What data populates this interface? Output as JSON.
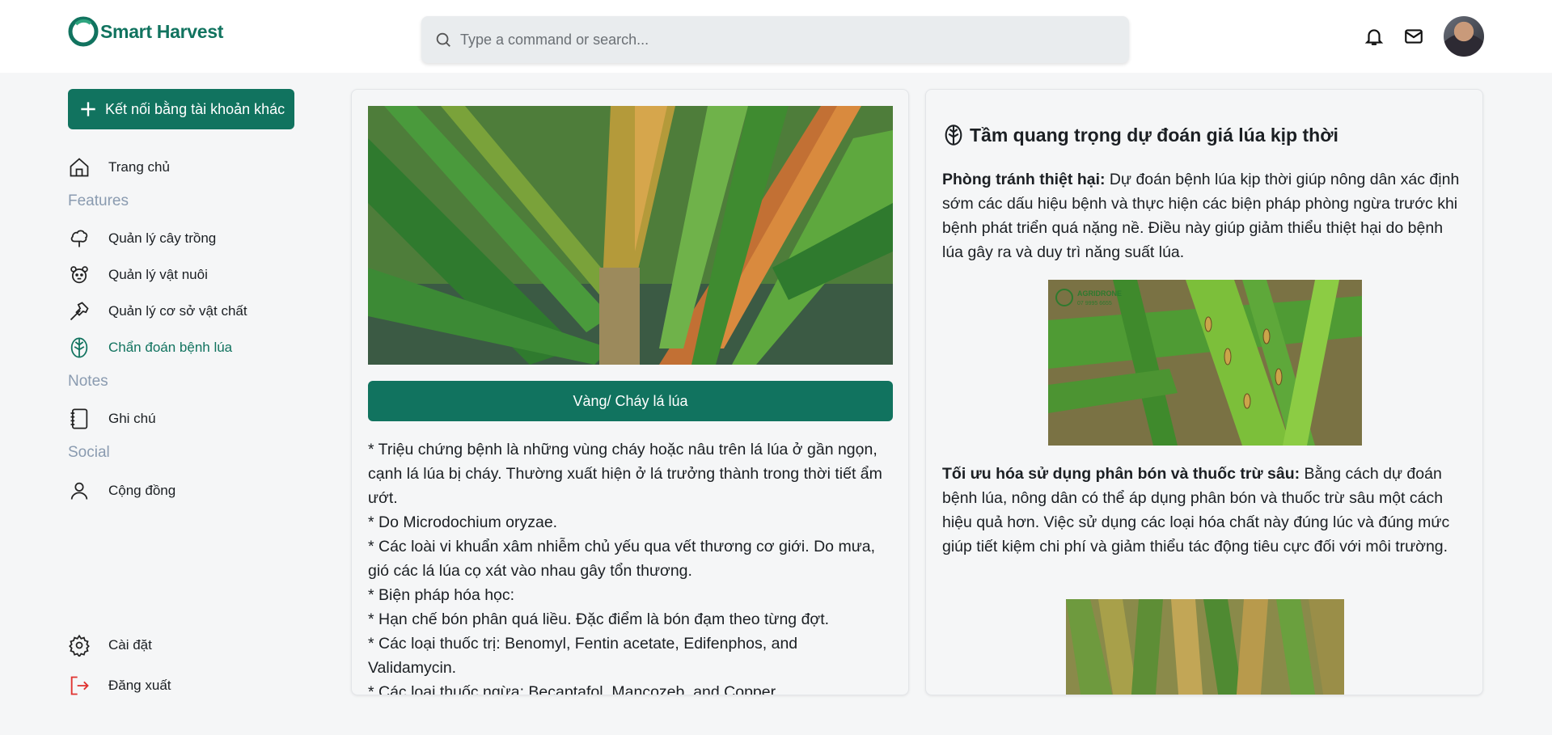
{
  "brand": {
    "name": "Smart Harvest",
    "color": "#11735f"
  },
  "search": {
    "placeholder": "Type a command or search...",
    "icon": "search-icon"
  },
  "header_icons": [
    "bell-icon",
    "mail-icon"
  ],
  "sidebar": {
    "connect_label": "Kết nối bằng tài khoản khác",
    "home": "Trang chủ",
    "features_title": "Features",
    "features": [
      {
        "label": "Quản lý cây trồng",
        "icon": "tree-icon"
      },
      {
        "label": "Quản lý vật nuôi",
        "icon": "animal-icon"
      },
      {
        "label": "Quản lý cơ sở vật chất",
        "icon": "hammer-icon"
      },
      {
        "label": "Chẩn đoán bệnh lúa",
        "icon": "leaf-icon",
        "active": true
      }
    ],
    "notes_title": "Notes",
    "notes": "Ghi chú",
    "social_title": "Social",
    "community": "Cộng đồng",
    "settings": "Cài đặt",
    "logout": "Đăng xuất"
  },
  "diagnosis": {
    "disease_label": "Vàng/ Cháy lá lúa",
    "lines": [
      "* Triệu chứng bệnh là những vùng cháy hoặc nâu trên lá lúa ở gần ngọn, cạnh lá lúa bị cháy. Thường xuất hiện ở lá trưởng thành trong thời tiết ẩm ướt.",
      "* Do Microdochium oryzae.",
      "* Các loài vi khuẩn xâm nhiễm chủ yếu qua vết thương cơ giới. Do mưa, gió các lá lúa cọ xát vào nhau gây tổn thương.",
      "* Biện pháp hóa học:",
      "* Hạn chế bón phân quá liều. Đặc điểm là bón đạm theo từng đợt.",
      "* Các loại thuốc trị: Benomyl, Fentin acetate, Edifenphos, and Validamycin.",
      "* Các loại thuốc ngừa: Becaptafol, Mancozeb, and Copper"
    ]
  },
  "importance": {
    "title": "Tầm quang trọng dự đoán giá lúa kịp thời",
    "p1_bold": "Phòng tránh thiệt hại:",
    "p1_text": " Dự đoán bệnh lúa kịp thời giúp nông dân xác định sớm các dấu hiệu bệnh và thực hiện các biện pháp phòng ngừa trước khi bệnh phát triển quá nặng nề. Điều này giúp giảm thiểu thiệt hại do bệnh lúa gây ra và duy trì năng suất lúa.",
    "watermark": "AGRIDRONE\n07 9995 6655",
    "p2_bold": "Tối ưu hóa sử dụng phân bón và thuốc trừ sâu:",
    "p2_text": " Bằng cách dự đoán bệnh lúa, nông dân có thể áp dụng phân bón và thuốc trừ sâu một cách hiệu quả hơn. Việc sử dụng các loại hóa chất này đúng lúc và đúng mức giúp tiết kiệm chi phí và giảm thiểu tác động tiêu cực đối với môi trường."
  }
}
